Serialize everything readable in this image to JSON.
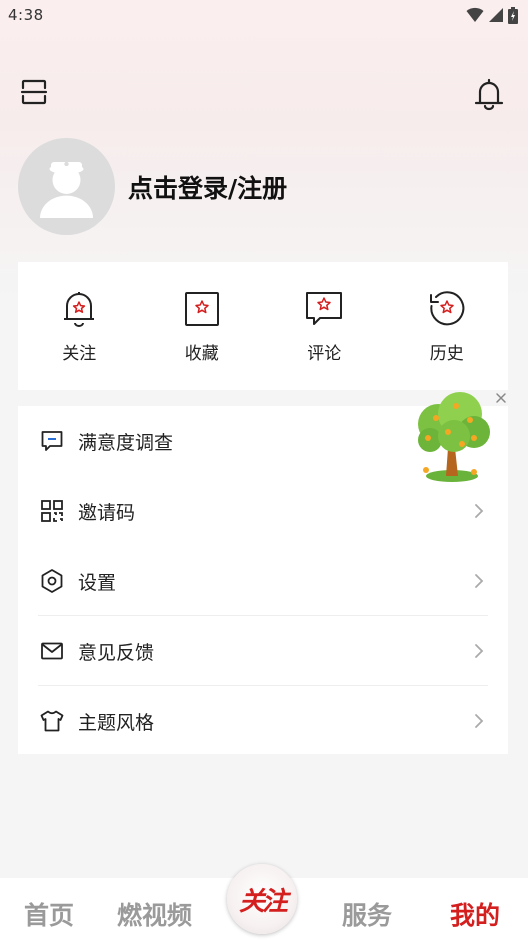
{
  "status_bar": {
    "time": "4:38"
  },
  "header": {
    "scan_icon": "scan-icon",
    "bell_icon": "bell-icon"
  },
  "profile": {
    "login_text": "点击登录/注册"
  },
  "quick_actions": [
    {
      "label": "关注",
      "icon": "bell-star-icon"
    },
    {
      "label": "收藏",
      "icon": "bookmark-star-icon"
    },
    {
      "label": "评论",
      "icon": "comment-star-icon"
    },
    {
      "label": "历史",
      "icon": "history-star-icon"
    }
  ],
  "menu": [
    {
      "label": "满意度调查",
      "icon": "survey-icon"
    },
    {
      "label": "邀请码",
      "icon": "qr-code-icon"
    },
    {
      "label": "设置",
      "icon": "settings-icon"
    },
    {
      "label": "意见反馈",
      "icon": "mail-icon"
    },
    {
      "label": "主题风格",
      "icon": "tshirt-icon"
    }
  ],
  "bottom_nav": {
    "home": "首页",
    "video": "燃视频",
    "center": "关注",
    "service": "服务",
    "mine": "我的"
  },
  "colors": {
    "accent": "#d41f1f",
    "inactive": "#9a9a9a"
  }
}
